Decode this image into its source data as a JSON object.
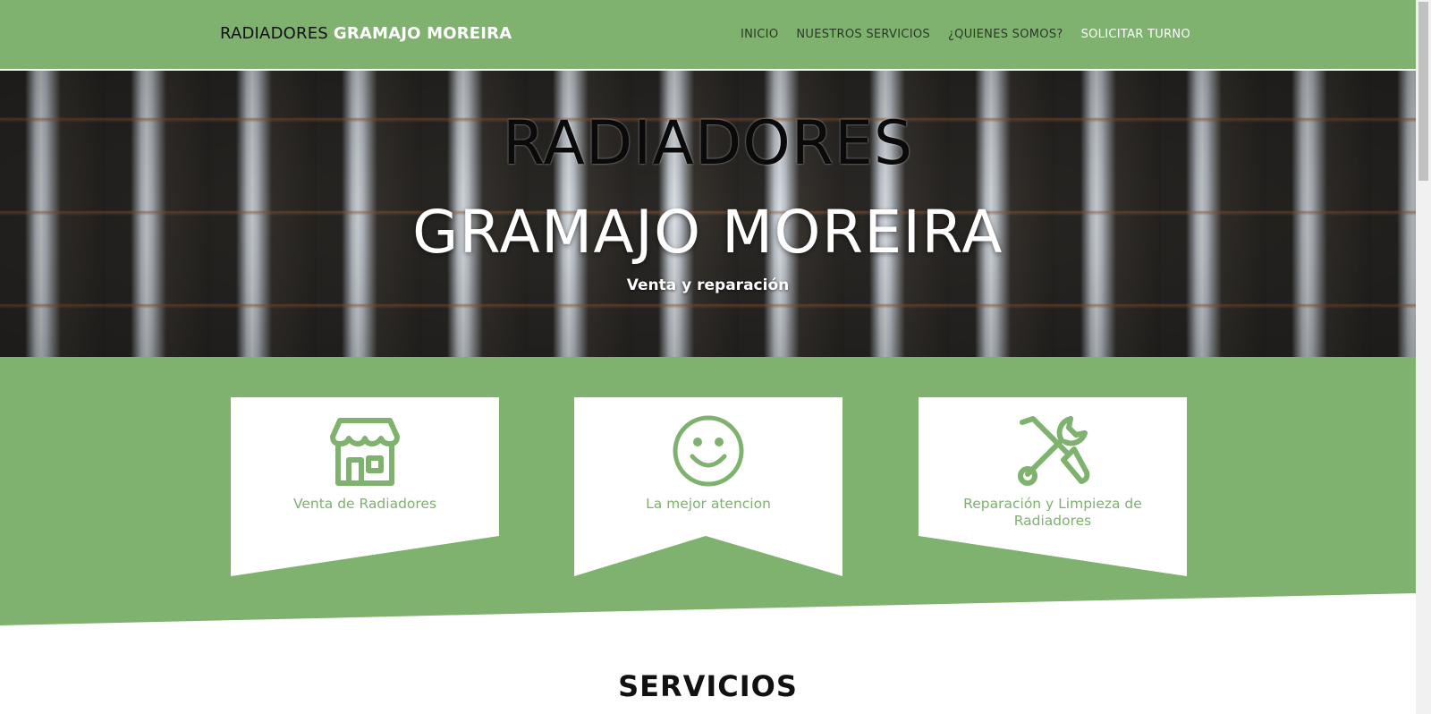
{
  "navbar": {
    "brand_dark": "RADIADORES",
    "brand_light": "GRAMAJO MOREIRA",
    "links": [
      {
        "label": "INICIO"
      },
      {
        "label": "NUESTROS SERVICIOS"
      },
      {
        "label": "¿QUIENES SOMOS?"
      },
      {
        "label": "SOLICITAR TURNO"
      }
    ]
  },
  "hero": {
    "title_line_1": "RADIADORES",
    "title_line_2": "GRAMAJO MOREIRA",
    "subtitle": "Venta y reparación"
  },
  "features": [
    {
      "label": "Venta de Radiadores",
      "icon": "store-icon"
    },
    {
      "label": "La mejor atencion",
      "icon": "smiley-icon"
    },
    {
      "label": "Reparación y Limpieza de Radiadores",
      "icon": "tools-icon"
    }
  ],
  "services": {
    "heading": "SERVICIOS"
  },
  "colors": {
    "brand_green": "#7eb26e",
    "white": "#ffffff",
    "text_dark": "#111111"
  }
}
